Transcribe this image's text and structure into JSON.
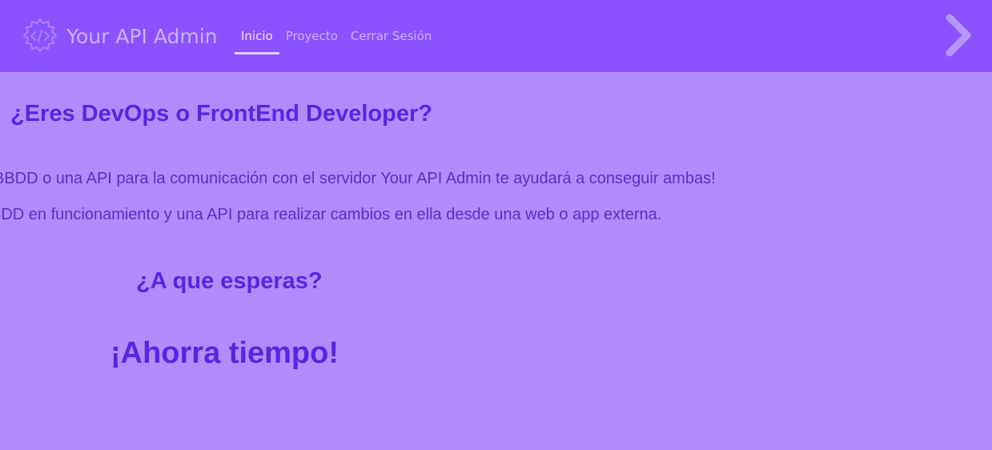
{
  "navbar": {
    "brand_name": "Your API Admin",
    "logo_icon": "code-gear-icon",
    "links": [
      {
        "label": "Inicio",
        "active": true
      },
      {
        "label": "Proyecto",
        "active": false
      },
      {
        "label": "Cerrar Sesión",
        "active": false
      }
    ],
    "next_icon": "chevron-right-icon"
  },
  "main": {
    "heading": "¿Eres DevOps o FrontEnd Developer?",
    "paragraph_1": "BBDD o una API para la comunicación con el servidor Your API Admin te ayudará a conseguir ambas!",
    "paragraph_2": "BDD en funcionamiento y una API para realizar cambios en ella desde una web o app externa.",
    "subheading": "¿A que esperas?",
    "cta": "¡Ahorra tiempo!"
  },
  "colors": {
    "navbar_bg": "#8c52ff",
    "page_bg": "#b18cfe",
    "heading": "#5a24e0",
    "text": "#5b2fbf",
    "nav_text": "#c9b2ff"
  }
}
